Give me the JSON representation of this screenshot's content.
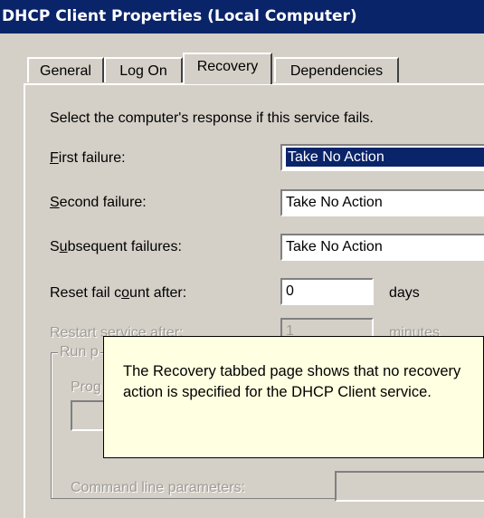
{
  "window": {
    "title": "DHCP Client Properties (Local Computer)"
  },
  "tabs": [
    {
      "label": "General"
    },
    {
      "label": "Log On"
    },
    {
      "label": "Recovery"
    },
    {
      "label": "Dependencies"
    }
  ],
  "recovery": {
    "instruction": "Select the computer's response if this service fails.",
    "first_failure": {
      "label": "First failure:",
      "value": "Take No Action"
    },
    "second_failure": {
      "label": "Second failure:",
      "value": "Take No Action"
    },
    "subsequent_failures": {
      "label": "Subsequent failures:",
      "value": "Take No Action"
    },
    "reset_fail_count": {
      "label": "Reset fail count after:",
      "value": "0",
      "unit": "days"
    },
    "restart_service": {
      "label": "Restart service after:",
      "value": "1",
      "unit": "minutes"
    },
    "run_program_group": {
      "label": "Run p",
      "program_label": "Prog"
    },
    "command_line_parameters": {
      "label": "Command line parameters:"
    }
  },
  "tooltip": {
    "text": "The Recovery tabbed page shows that no recovery action is specified for the DHCP Client service."
  },
  "colors": {
    "title_bar": "#0a246a",
    "dialog_face": "#d4d0c8",
    "tooltip_bg": "#ffffe1"
  }
}
